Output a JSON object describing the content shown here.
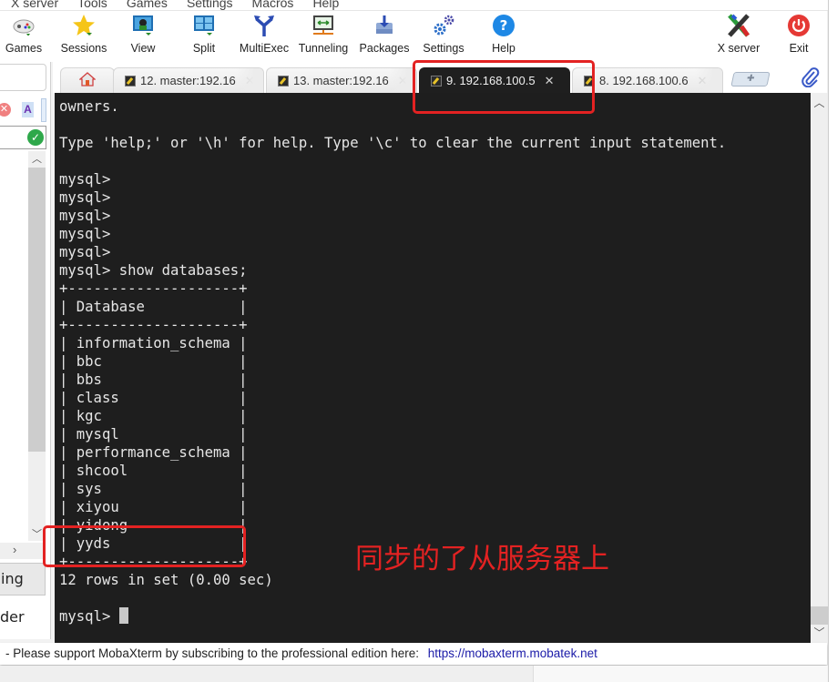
{
  "menu": [
    "X server",
    "Tools",
    "Games",
    "Settings",
    "Macros",
    "Help"
  ],
  "toolbar": {
    "buttons": [
      {
        "label": "Games",
        "icon": "gamepad-icon"
      },
      {
        "label": "Sessions",
        "icon": "star-icon"
      },
      {
        "label": "View",
        "icon": "monitor-user-icon"
      },
      {
        "label": "Split",
        "icon": "split-screen-icon"
      },
      {
        "label": "MultiExec",
        "icon": "fork-arrow-icon"
      },
      {
        "label": "Tunneling",
        "icon": "tunnel-monitor-icon"
      },
      {
        "label": "Packages",
        "icon": "package-download-icon"
      },
      {
        "label": "Settings",
        "icon": "gears-icon"
      },
      {
        "label": "Help",
        "icon": "question-circle-icon"
      }
    ],
    "right_buttons": [
      {
        "label": "X server",
        "icon": "x-server-icon"
      },
      {
        "label": "Exit",
        "icon": "power-icon"
      }
    ]
  },
  "sidebar": {
    "tab1_label": "ing",
    "tab2_label": "der"
  },
  "tabs": [
    {
      "label": "",
      "icon": "home-icon",
      "active": false
    },
    {
      "label": "12. master:192.16",
      "active": false
    },
    {
      "label": "13. master:192.16",
      "active": false
    },
    {
      "label": "9. 192.168.100.5",
      "active": true
    },
    {
      "label": "8. 192.168.100.6",
      "active": false
    }
  ],
  "terminal": {
    "lines": [
      "owners.",
      "",
      "Type 'help;' or '\\h' for help. Type '\\c' to clear the current input statement.",
      "",
      "mysql>",
      "mysql>",
      "mysql>",
      "mysql>",
      "mysql>",
      "mysql> show databases;",
      "+--------------------+",
      "| Database           |",
      "+--------------------+",
      "| information_schema |",
      "| bbc                |",
      "| bbs                |",
      "| class              |",
      "| kgc                |",
      "| mysql              |",
      "| performance_schema |",
      "| shcool             |",
      "| sys                |",
      "| xiyou              |",
      "| yidong             |",
      "| yyds               |",
      "+--------------------+",
      "12 rows in set (0.00 sec)",
      "",
      "mysql> "
    ],
    "prompt_line_index": 28
  },
  "query_result": {
    "command": "show databases;",
    "column": "Database",
    "rows": [
      "information_schema",
      "bbc",
      "bbs",
      "class",
      "kgc",
      "mysql",
      "performance_schema",
      "shcool",
      "sys",
      "xiyou",
      "yidong",
      "yyds"
    ],
    "summary": "12 rows in set (0.00 sec)"
  },
  "annotation": {
    "text": "同步的了从服务器上",
    "color": "#e32222"
  },
  "statusbar": {
    "text": " -  Please support MobaXterm by subscribing to the professional edition here: ",
    "link": "https://mobaxterm.mobatek.net"
  },
  "colors": {
    "terminal_bg": "#1e1e1e",
    "terminal_fg": "#e6e6e6",
    "link": "#1a1aa8",
    "annotation_red": "#e32222"
  }
}
